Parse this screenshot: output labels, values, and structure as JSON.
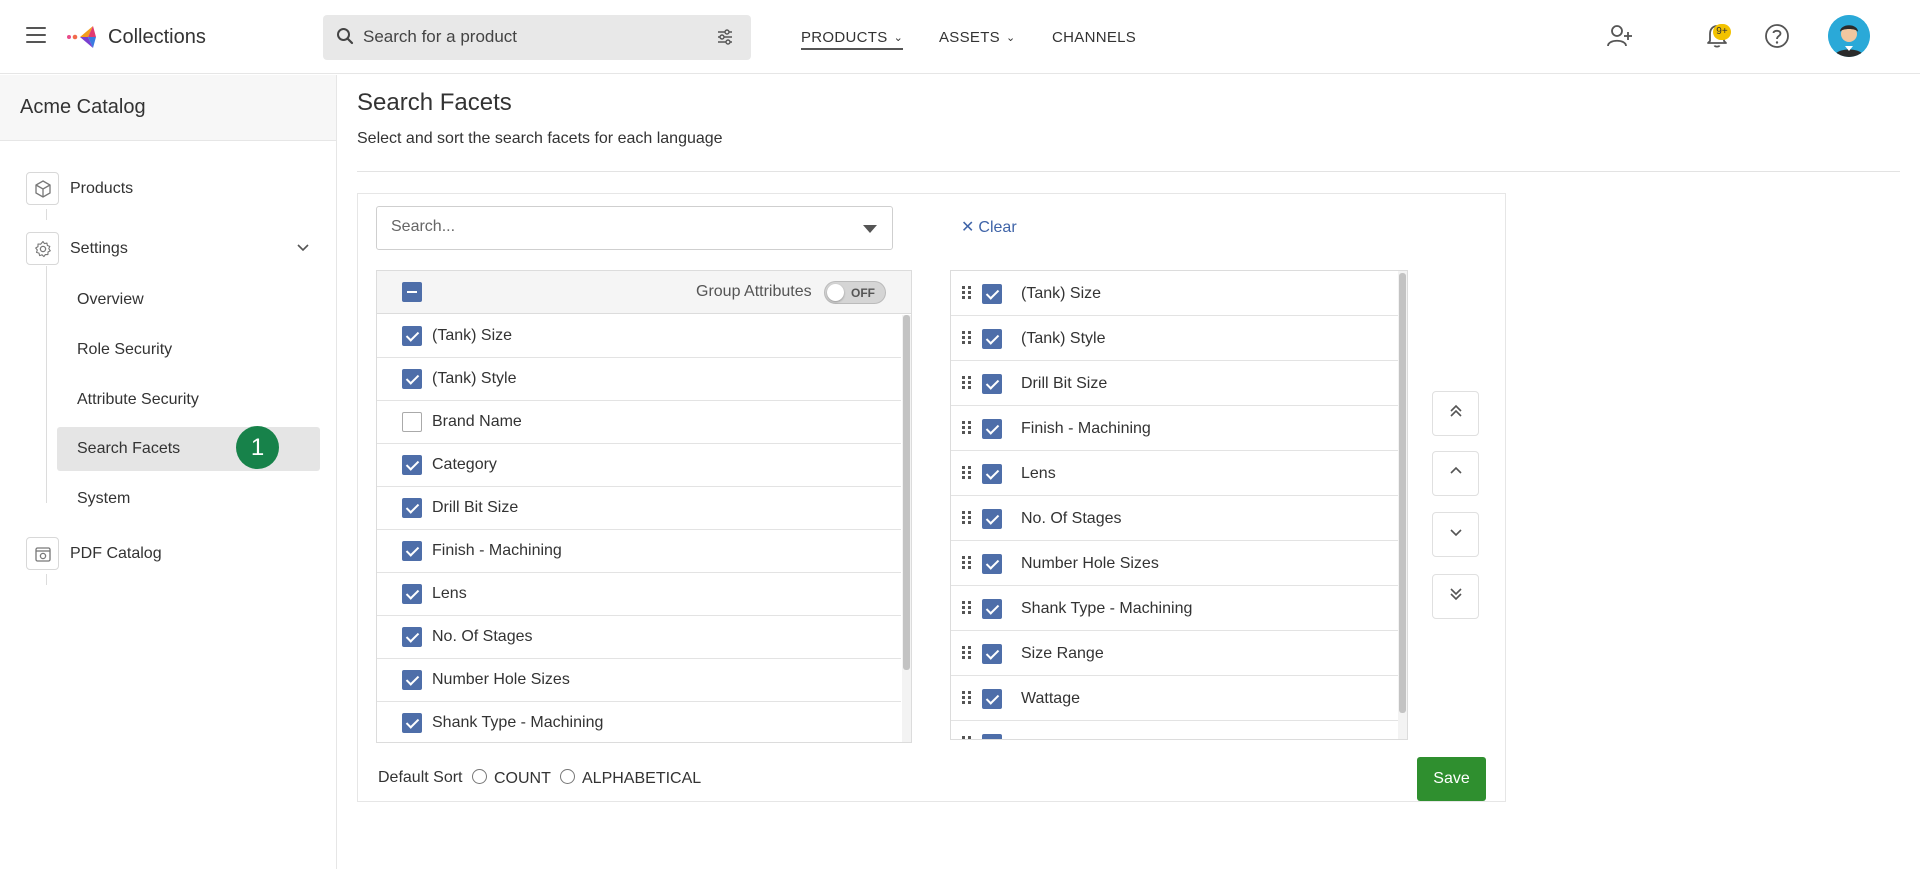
{
  "app": {
    "title": "Collections",
    "menu_icon": "hamburger-menu-icon",
    "logo_icon": "collections-logo-icon"
  },
  "search": {
    "placeholder": "Search for a product",
    "icon": "search-icon",
    "filter_icon": "filter-sliders-icon"
  },
  "nav": {
    "products": "PRODUCTS",
    "assets": "ASSETS",
    "channels": "CHANNELS"
  },
  "top_icons": {
    "add_user": "add-user-icon",
    "notifications": "bell-icon",
    "notifications_badge": "9+",
    "help": "help-icon"
  },
  "sidebar": {
    "catalog_title": "Acme Catalog",
    "products": "Products",
    "settings": "Settings",
    "sub_items": [
      "Overview",
      "Role Security",
      "Attribute Security",
      "Search Facets",
      "System"
    ],
    "active_item": "Search Facets",
    "step_number": "1",
    "pdf_catalog": "PDF Catalog"
  },
  "main": {
    "title": "Search Facets",
    "subtitle": "Select and sort the search facets for each language",
    "search_placeholder": "Search...",
    "clear_label": "Clear",
    "group_attributes_label": "Group Attributes",
    "group_attributes_toggle": "OFF",
    "available_facets": [
      {
        "label": "(Tank) Size",
        "checked": true
      },
      {
        "label": "(Tank) Style",
        "checked": true
      },
      {
        "label": "Brand Name",
        "checked": false
      },
      {
        "label": "Category",
        "checked": true
      },
      {
        "label": "Drill Bit Size",
        "checked": true
      },
      {
        "label": "Finish - Machining",
        "checked": true
      },
      {
        "label": "Lens",
        "checked": true
      },
      {
        "label": "No. Of Stages",
        "checked": true
      },
      {
        "label": "Number Hole Sizes",
        "checked": true
      },
      {
        "label": "Shank Type - Machining",
        "checked": true
      }
    ],
    "selected_facets": [
      "(Tank) Size",
      "(Tank) Style",
      "Drill Bit Size",
      "Finish - Machining",
      "Lens",
      "No. Of Stages",
      "Number Hole Sizes",
      "Shank Type - Machining",
      "Size Range",
      "Wattage"
    ],
    "default_sort_label": "Default Sort",
    "sort_options": [
      "COUNT",
      "ALPHABETICAL"
    ],
    "save_label": "Save"
  },
  "colors": {
    "checkbox": "#4e6ea9",
    "save": "#2f8f2f",
    "step_badge": "#17824a",
    "clear_link": "#3f64a8",
    "badge": "#f2c200"
  }
}
